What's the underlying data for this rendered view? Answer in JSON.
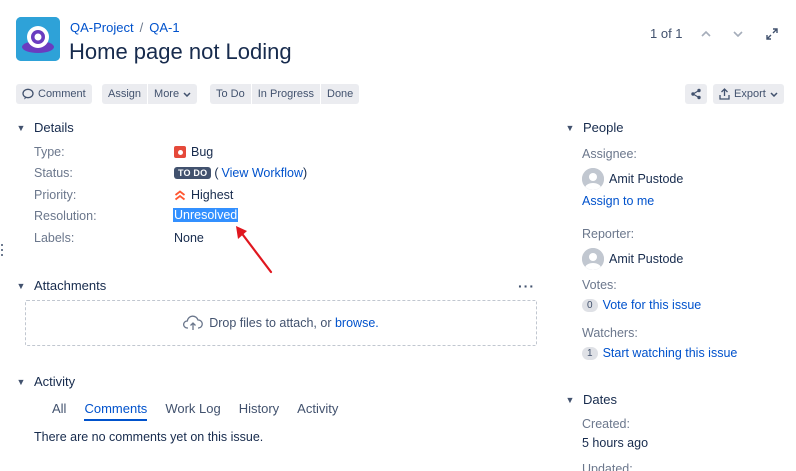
{
  "header": {
    "breadcrumb": {
      "project": "QA-Project",
      "separator": "/",
      "issue_key": "QA-1"
    },
    "title": "Home page not Loding",
    "pager": "1 of 1"
  },
  "toolbar": {
    "comment": "Comment",
    "assign": "Assign",
    "more": "More",
    "todo": "To Do",
    "in_progress": "In Progress",
    "done": "Done",
    "export": "Export"
  },
  "details": {
    "heading": "Details",
    "type_label": "Type:",
    "type_value": "Bug",
    "status_label": "Status:",
    "status_value": "TO DO",
    "workflow_open": "(",
    "workflow_link": "View Workflow",
    "workflow_close": ")",
    "priority_label": "Priority:",
    "priority_value": "Highest",
    "resolution_label": "Resolution:",
    "resolution_value": "Unresolved",
    "labels_label": "Labels:",
    "labels_value": "None"
  },
  "attachments": {
    "heading": "Attachments",
    "drop_text": "Drop files to attach, or ",
    "browse_link": "browse."
  },
  "activity": {
    "heading": "Activity",
    "tabs": [
      "All",
      "Comments",
      "Work Log",
      "History",
      "Activity"
    ],
    "active_tab": "Comments",
    "empty_text": "There are no comments yet on this issue."
  },
  "people": {
    "heading": "People",
    "assignee_label": "Assignee:",
    "assignee_name": "Amit Pustode",
    "assign_to_me": "Assign to me",
    "reporter_label": "Reporter:",
    "reporter_name": "Amit Pustode",
    "votes_label": "Votes:",
    "votes_count": "0",
    "vote_link": "Vote for this issue",
    "watchers_label": "Watchers:",
    "watchers_count": "1",
    "watch_link": "Start watching this issue"
  },
  "dates": {
    "heading": "Dates",
    "created_label": "Created:",
    "created_value": "5 hours ago",
    "updated_label": "Updated:"
  },
  "colors": {
    "link": "#0052cc",
    "status_lozenge": "#42526e",
    "bug": "#e5493a",
    "priority": "#ff5630",
    "annotation_arrow": "#e0171f",
    "selection": "#3390ff"
  }
}
